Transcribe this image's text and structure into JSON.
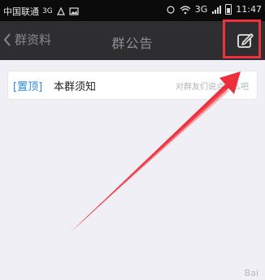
{
  "status_bar": {
    "carrier": "中国联通",
    "network_left": "3G",
    "network_right": "3G",
    "time": "11:47"
  },
  "nav": {
    "back_label": "群资料",
    "title": "群公告",
    "edit_icon": "edit-compose-icon"
  },
  "notice": {
    "tag": "[置顶]",
    "title": "本群须知",
    "preview": "对群友们说点什么吧"
  },
  "annotation": {
    "color": "#f0303c"
  },
  "watermark": "Bai"
}
